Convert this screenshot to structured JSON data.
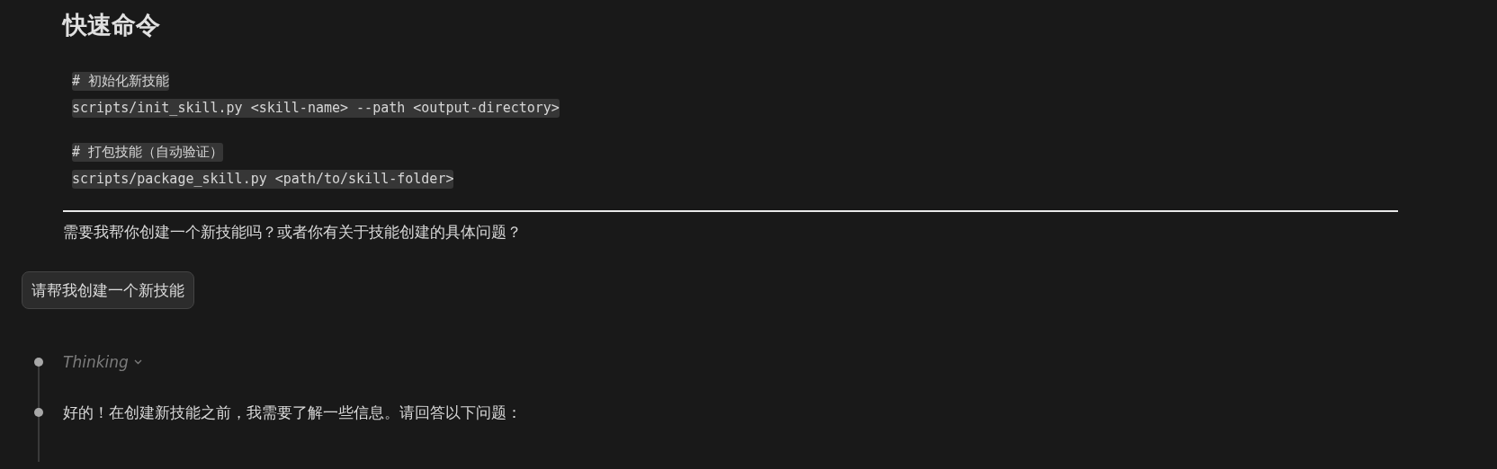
{
  "heading": "快速命令",
  "code_groups": [
    [
      "# 初始化新技能",
      "scripts/init_skill.py <skill-name> --path <output-directory>"
    ],
    [
      "# 打包技能（自动验证）",
      "scripts/package_skill.py <path/to/skill-folder>"
    ]
  ],
  "question": "需要我帮你创建一个新技能吗？或者你有关于技能创建的具体问题？",
  "user_message": "请帮我创建一个新技能",
  "timeline": [
    {
      "kind": "thinking",
      "text": "Thinking"
    },
    {
      "kind": "answer",
      "text": "好的！在创建新技能之前，我需要了解一些信息。请回答以下问题："
    }
  ]
}
